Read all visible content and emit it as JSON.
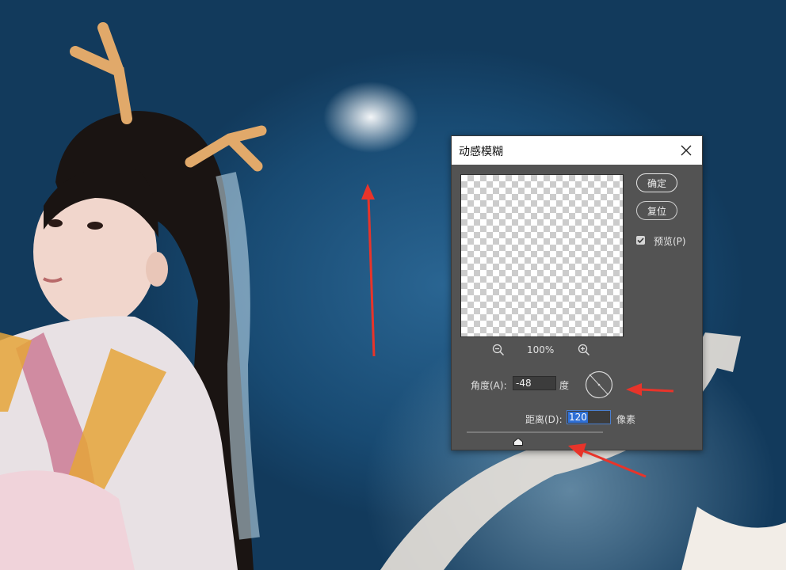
{
  "dialog": {
    "title": "动感模糊",
    "ok_label": "确定",
    "reset_label": "复位",
    "preview_label": "预览(P)",
    "preview_checked": true,
    "zoom_level": "100%",
    "angle": {
      "label": "角度(A):",
      "value": "-48",
      "unit": "度"
    },
    "distance": {
      "label": "距离(D):",
      "value": "120",
      "unit": "像素",
      "slider_fraction": 0.38
    }
  },
  "colors": {
    "annotation_arrow": "#e8342a",
    "dialog_bg": "#535353",
    "selection": "#2e6fd6"
  },
  "icons": [
    "close-icon",
    "zoom-out-icon",
    "zoom-in-icon",
    "check-icon",
    "angle-dial-icon",
    "slider-thumb-icon"
  ]
}
